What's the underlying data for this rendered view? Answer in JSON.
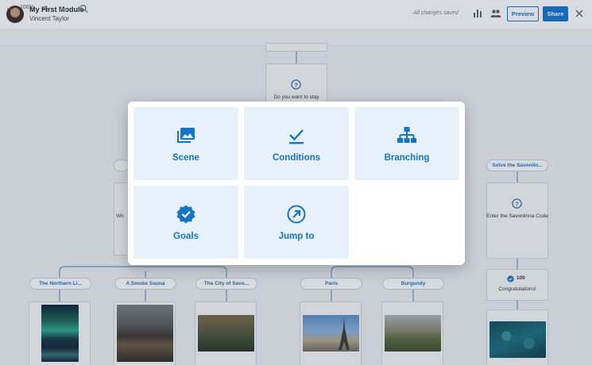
{
  "header": {
    "module_title": "My First Module",
    "author": "Vincent Taylor",
    "save_status": "All changes saved",
    "preview_label": "Preview",
    "share_label": "Share"
  },
  "toolbar": {
    "zoom_level": "100%"
  },
  "canvas": {
    "top_question": "Do you want to stay",
    "left_question_partial": "Wh",
    "right_branch_label": "Solve the Savonlin...",
    "right_question": "Enter the Savonlinna Code",
    "goal_points": "100",
    "goal_text": "Congratulations!",
    "branches": [
      {
        "label": "The Northern Li..."
      },
      {
        "label": "A Smoke Sauna"
      },
      {
        "label": "The City of Savo..."
      },
      {
        "label": "Paris"
      },
      {
        "label": "Burgundy"
      }
    ]
  },
  "modal": {
    "options": [
      {
        "label": "Scene",
        "icon": "scene-icon"
      },
      {
        "label": "Conditions",
        "icon": "checkmark-icon"
      },
      {
        "label": "Branching",
        "icon": "branching-icon"
      },
      {
        "label": "Goals",
        "icon": "goal-badge-icon"
      },
      {
        "label": "Jump to",
        "icon": "jump-arrow-icon"
      }
    ]
  },
  "colors": {
    "accent": "#1473cf",
    "tile_bg": "#e6f1fb",
    "tile_text": "#1673c6"
  }
}
